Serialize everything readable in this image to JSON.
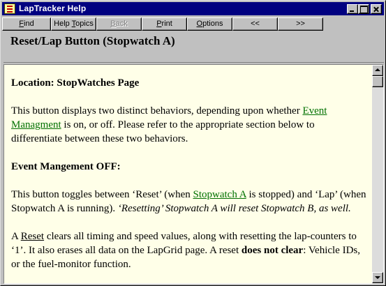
{
  "window": {
    "title": "LapTracker Help"
  },
  "toolbar": {
    "find": {
      "pre": "",
      "acc": "F",
      "post": "ind"
    },
    "help_topics": {
      "pre": "Help ",
      "acc": "T",
      "post": "opics"
    },
    "back": {
      "pre": "",
      "acc": "B",
      "post": "ack"
    },
    "print": {
      "pre": "",
      "acc": "P",
      "post": "rint"
    },
    "options": {
      "pre": "",
      "acc": "O",
      "post": "ptions"
    },
    "prev": "<<",
    "next": ">>"
  },
  "topic": {
    "title": "Reset/Lap Button (Stopwatch A)"
  },
  "content": {
    "location": "Location: StopWatches Page",
    "p1_before": "This button displays two distinct behaviors, depending upon whether ",
    "p1_link": "Event Managment",
    "p1_after": " is on, or off.  Please refer to the appropriate section below to differentiate between these two behaviors.",
    "event_heading": "Event Mangement OFF:",
    "p2_before": "This button toggles between ‘Reset’ (when ",
    "p2_link": "Stopwatch A",
    "p2_after": " is stopped) and ‘Lap’ (when Stopwatch A is running). ",
    "p2_italic": "‘Resetting’ Stopwatch A will reset Stopwatch B, as well.",
    "p3_a": "A ",
    "p3_reset": "Reset",
    "p3_b": " clears all timing and speed values, along with resetting the lap-counters to ‘1’. It also erases all data on the LapGrid page. A reset ",
    "p3_bold": "does not clear",
    "p3_c": ": Vehicle IDs, or the fuel-monitor function."
  }
}
